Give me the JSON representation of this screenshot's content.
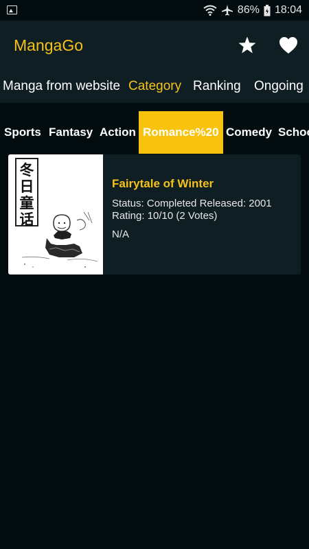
{
  "status_bar": {
    "battery": "86%",
    "time": "18:04",
    "icons": [
      "gallery-icon",
      "wifi-icon",
      "airplane-icon",
      "battery-icon"
    ]
  },
  "app_bar": {
    "title": "MangaGo",
    "actions": [
      "star-icon",
      "heart-icon"
    ]
  },
  "tabs": [
    {
      "label": "Manga from website"
    },
    {
      "label": "Category",
      "active": true
    },
    {
      "label": "Ranking"
    },
    {
      "label": "Ongoing"
    }
  ],
  "genres": [
    {
      "label": "Sports"
    },
    {
      "label": "Fantasy"
    },
    {
      "label": "Action"
    },
    {
      "label": "Romance%20",
      "active": true
    },
    {
      "label": "Comedy"
    },
    {
      "label": "Schoo"
    }
  ],
  "manga": {
    "cover_chars": [
      "冬",
      "日",
      "童",
      "话"
    ],
    "title": "Fairytale of Winter",
    "status_line": "Status: Completed Released: 2001",
    "rating_line": "Rating: 10/10 (2 Votes)",
    "extra": "N/A"
  },
  "colors": {
    "accent": "#f5c21b",
    "app_bar": "#0f1e23",
    "background": "#030d0f"
  }
}
